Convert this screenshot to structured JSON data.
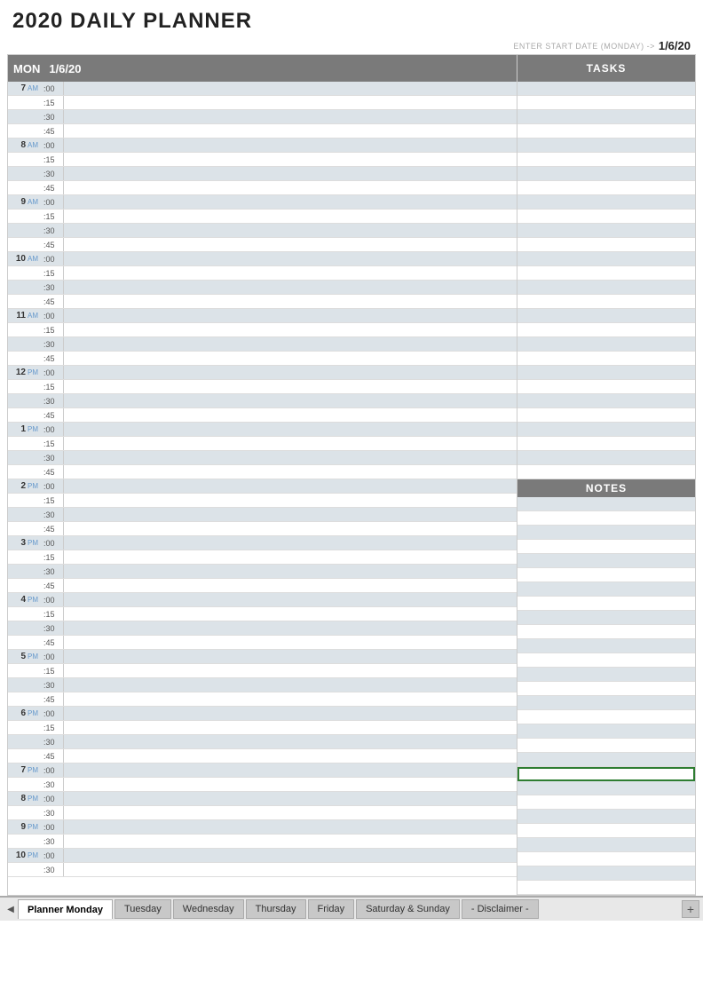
{
  "app": {
    "title": "2020 DAILY PLANNER"
  },
  "date_entry": {
    "label": "ENTER START DATE (MONDAY) ->",
    "value": "1/6/20"
  },
  "schedule": {
    "day": "MON",
    "date": "1/6/20",
    "hours": [
      {
        "hour": "7",
        "ampm": "AM",
        "slots": [
          ":00",
          ":15",
          ":30",
          ":45"
        ]
      },
      {
        "hour": "8",
        "ampm": "AM",
        "slots": [
          ":00",
          ":15",
          ":30",
          ":45"
        ]
      },
      {
        "hour": "9",
        "ampm": "AM",
        "slots": [
          ":00",
          ":15",
          ":30",
          ":45"
        ]
      },
      {
        "hour": "10",
        "ampm": "AM",
        "slots": [
          ":00",
          ":15",
          ":30",
          ":45"
        ]
      },
      {
        "hour": "11",
        "ampm": "AM",
        "slots": [
          ":00",
          ":15",
          ":30",
          ":45"
        ]
      },
      {
        "hour": "12",
        "ampm": "PM",
        "slots": [
          ":00",
          ":15",
          ":30",
          ":45"
        ]
      },
      {
        "hour": "1",
        "ampm": "PM",
        "slots": [
          ":00",
          ":15",
          ":30",
          ":45"
        ]
      },
      {
        "hour": "2",
        "ampm": "PM",
        "slots": [
          ":00",
          ":15",
          ":30",
          ":45"
        ]
      },
      {
        "hour": "3",
        "ampm": "PM",
        "slots": [
          ":00",
          ":15",
          ":30",
          ":45"
        ]
      },
      {
        "hour": "4",
        "ampm": "PM",
        "slots": [
          ":00",
          ":15",
          ":30",
          ":45"
        ]
      },
      {
        "hour": "5",
        "ampm": "PM",
        "slots": [
          ":00",
          ":15",
          ":30",
          ":45"
        ]
      },
      {
        "hour": "6",
        "ampm": "PM",
        "slots": [
          ":00",
          ":15",
          ":30",
          ":45"
        ]
      },
      {
        "hour": "7",
        "ampm": "PM",
        "slots": [
          ":00",
          ":30"
        ]
      },
      {
        "hour": "8",
        "ampm": "PM",
        "slots": [
          ":00",
          ":30"
        ]
      },
      {
        "hour": "9",
        "ampm": "PM",
        "slots": [
          ":00",
          ":30"
        ]
      },
      {
        "hour": "10",
        "ampm": "PM",
        "slots": [
          ":00",
          ":30"
        ]
      }
    ]
  },
  "tasks": {
    "header": "TASKS",
    "count": 28
  },
  "notes": {
    "header": "NOTES",
    "count": 32
  },
  "tabs": {
    "items": [
      {
        "label": "Planner Monday",
        "active": true
      },
      {
        "label": "Tuesday",
        "active": false
      },
      {
        "label": "Wednesday",
        "active": false
      },
      {
        "label": "Thursday",
        "active": false
      },
      {
        "label": "Friday",
        "active": false
      },
      {
        "label": "Saturday & Sunday",
        "active": false
      },
      {
        "label": "- Disclaimer -",
        "active": false
      }
    ]
  }
}
